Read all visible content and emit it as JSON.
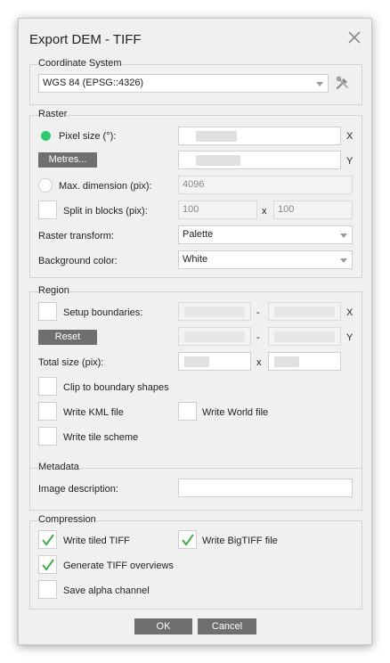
{
  "dialog": {
    "title": "Export DEM - TIFF"
  },
  "coordinate_system": {
    "group_title": "Coordinate System",
    "selected": "WGS 84 (EPSG::4326)"
  },
  "raster": {
    "group_title": "Raster",
    "pixel_size_label": "Pixel size (°):",
    "metres_button": "Metres...",
    "x_axis": "X",
    "y_axis": "Y",
    "max_dimension_label": "Max. dimension (pix):",
    "max_dimension_value": "4096",
    "split_blocks_label": "Split in blocks (pix):",
    "split_x_value": "100",
    "split_y_value": "100",
    "times": "x",
    "raster_transform_label": "Raster transform:",
    "raster_transform_value": "Palette",
    "background_color_label": "Background color:",
    "background_color_value": "White"
  },
  "region": {
    "group_title": "Region",
    "setup_boundaries_label": "Setup boundaries:",
    "reset_button": "Reset",
    "dash": "-",
    "x_axis": "X",
    "y_axis": "Y",
    "total_size_label": "Total size (pix):",
    "times": "x",
    "clip_label": "Clip to boundary shapes",
    "kml_label": "Write KML file",
    "world_label": "Write World file",
    "tile_scheme_label": "Write tile scheme"
  },
  "metadata": {
    "group_title": "Metadata",
    "image_description_label": "Image description:",
    "image_description_value": ""
  },
  "compression": {
    "group_title": "Compression",
    "tiled_label": "Write tiled TIFF",
    "tiled_checked": true,
    "bigtiff_label": "Write BigTIFF file",
    "bigtiff_checked": true,
    "overviews_label": "Generate TIFF overviews",
    "overviews_checked": true,
    "alpha_label": "Save alpha channel",
    "alpha_checked": false
  },
  "buttons": {
    "ok": "OK",
    "cancel": "Cancel"
  },
  "colors": {
    "accent_green": "#2ecc71",
    "button_gray": "#6f6f6f",
    "check_green": "#3cb043"
  },
  "icons": {
    "close": "close-icon",
    "tools": "tools-icon",
    "check": "checkmark-icon"
  }
}
